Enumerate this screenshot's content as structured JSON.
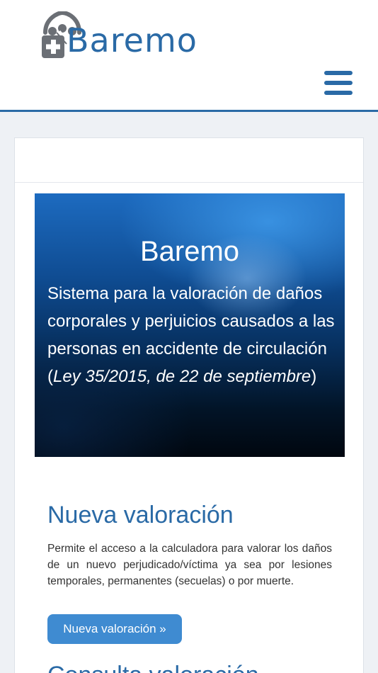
{
  "header": {
    "logo_text": "Baremo",
    "menu_icon": "hamburger-menu-icon",
    "brand_color": "#2a6aa6"
  },
  "hero": {
    "title": "Baremo",
    "text_plain": "Sistema para la valoración de daños corporales y perjuicios causados a las personas en accidente de circulación (",
    "text_italic": "Ley 35/2015, de 22 de septiembre",
    "text_close": ")"
  },
  "section": {
    "title": "Nueva valoración",
    "description": "Permite el acceso a la calculadora para valorar los daños de un nuevo perjudicado/víctima ya sea por lesiones temporales, permanentes (secuelas) o por muerte.",
    "button_label": "Nueva valoración »",
    "button_color": "#3f8bd1"
  },
  "next_section": {
    "title": "Consulta valoración"
  }
}
